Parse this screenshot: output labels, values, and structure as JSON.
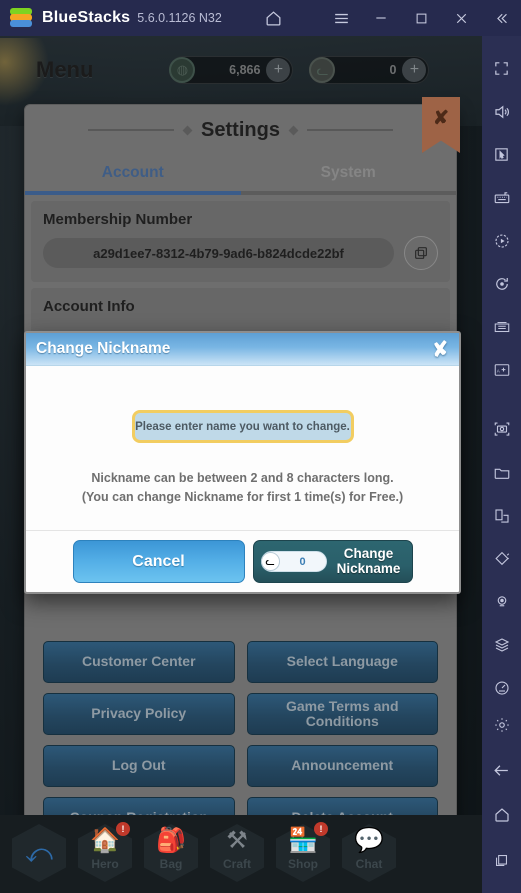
{
  "titlebar": {
    "app_name": "BlueStacks",
    "version": "5.6.0.1126 N32",
    "icons": [
      "home-icon",
      "menu-icon",
      "minimize-icon",
      "maximize-icon",
      "close-icon",
      "collapse-icon"
    ]
  },
  "game_topbar": {
    "title": "Menu",
    "resources": [
      {
        "icon": "coin-icon",
        "value": "6,866",
        "plus": "+"
      },
      {
        "icon": "cat-coin-icon",
        "value": "0",
        "plus": "+"
      }
    ]
  },
  "settings": {
    "title": "Settings",
    "close_label": "✘",
    "tabs": [
      {
        "label": "Account",
        "active": true
      },
      {
        "label": "System",
        "active": false
      }
    ],
    "membership": {
      "label": "Membership Number",
      "value": "a29d1ee7-8312-4b79-9ad6-b824dcde22bf",
      "copy_icon": "copy-icon"
    },
    "account_info": {
      "label": "Account Info"
    },
    "menu_buttons": [
      "Customer Center",
      "Select Language",
      "Privacy Policy",
      "Game Terms and Conditions",
      "Log Out",
      "Announcement",
      "Coupon Registration",
      "Delete Account"
    ]
  },
  "modal": {
    "title": "Change Nickname",
    "close_label": "✘",
    "input_placeholder": "Please enter name you want to change.",
    "input_value": "",
    "hint_line1": "Nickname can be between 2 and 8 characters long.",
    "hint_line2": "(You can change Nickname for first 1 time(s) for Free.)",
    "cancel_label": "Cancel",
    "confirm_label": "Change Nickname",
    "cost_value": "0",
    "cost_icon": "cat-coin-icon"
  },
  "bottom_nav": {
    "back_icon": "back-arrow-icon",
    "items": [
      {
        "label": "Hero",
        "icon": "hero-icon",
        "badge": "!"
      },
      {
        "label": "Bag",
        "icon": "bag-icon",
        "badge": ""
      },
      {
        "label": "Craft",
        "icon": "craft-icon",
        "badge": ""
      },
      {
        "label": "Shop",
        "icon": "shop-icon",
        "badge": "!"
      },
      {
        "label": "Chat",
        "icon": "chat-icon",
        "badge": ""
      }
    ]
  },
  "sidebar": {
    "items": [
      "fullscreen-icon",
      "volume-icon",
      "cursor-icon",
      "keyboard-icon",
      "macro-play-icon",
      "rotate-icon",
      "multi-instance-icon",
      "install-apk-icon",
      "screenshot-icon",
      "folder-icon",
      "screen-split-icon",
      "shake-icon",
      "location-icon",
      "layers-icon",
      "gauge-icon"
    ],
    "bottom_items": [
      "gear-icon",
      "back-icon",
      "home-icon",
      "recents-icon"
    ]
  },
  "colors": {
    "accent_blue": "#3b5c8a",
    "modal_header": "#79b6e4",
    "cancel_button": "#53aee6",
    "confirm_button": "#2a5f6a",
    "input_border": "#f2cd61",
    "badge_red": "#c0392b"
  }
}
